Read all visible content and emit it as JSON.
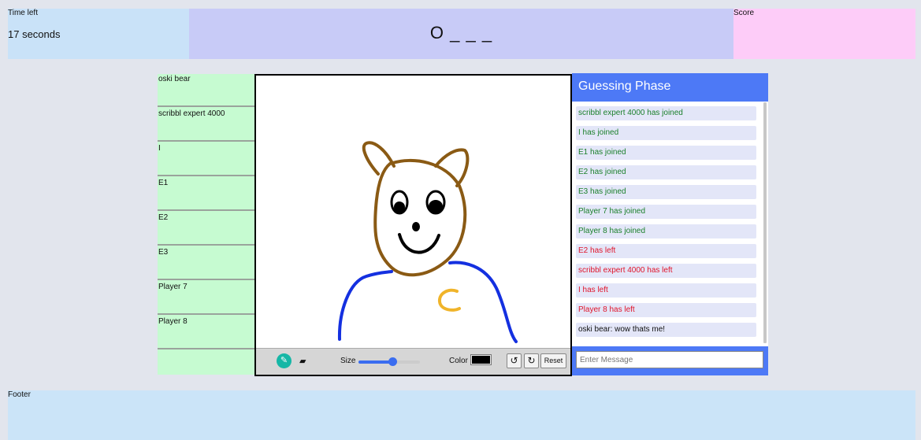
{
  "header": {
    "time_label": "Time left",
    "time_value": "17 seconds",
    "word_hint": "O _ _ _",
    "score_label": "Score"
  },
  "players": [
    "oski bear",
    "scribbl expert 4000",
    "I",
    "E1",
    "E2",
    "E3",
    "Player 7",
    "Player 8"
  ],
  "toolbar": {
    "brush_icon": "paintbrush-icon",
    "eraser_icon": "eraser-icon",
    "size_label": "Size",
    "size_value_fraction": 0.55,
    "color_label": "Color",
    "current_color": "#000000",
    "undo_icon": "undo-icon",
    "redo_icon": "redo-icon",
    "reset_label": "Reset"
  },
  "chat": {
    "title": "Guessing Phase",
    "input_placeholder": "Enter Message",
    "messages": [
      {
        "text": "scribbl expert 4000 has joined",
        "kind": "join"
      },
      {
        "text": "I has joined",
        "kind": "join"
      },
      {
        "text": "E1 has joined",
        "kind": "join"
      },
      {
        "text": "E2 has joined",
        "kind": "join"
      },
      {
        "text": "E3 has joined",
        "kind": "join"
      },
      {
        "text": "Player 7 has joined",
        "kind": "join"
      },
      {
        "text": "Player 8 has joined",
        "kind": "join"
      },
      {
        "text": "E2 has left",
        "kind": "leave"
      },
      {
        "text": "scribbl expert 4000 has left",
        "kind": "leave"
      },
      {
        "text": "I has left",
        "kind": "leave"
      },
      {
        "text": "Player 8 has left",
        "kind": "leave"
      },
      {
        "text": "oski bear: wow thats me!",
        "kind": "chat"
      }
    ]
  },
  "colors": {
    "join": "#1a7f2a",
    "leave": "#e0142a",
    "chat": "#111111",
    "header_blue": "#4d79f6",
    "player_green": "#c6fbd1"
  },
  "footer": {
    "label": "Footer"
  }
}
